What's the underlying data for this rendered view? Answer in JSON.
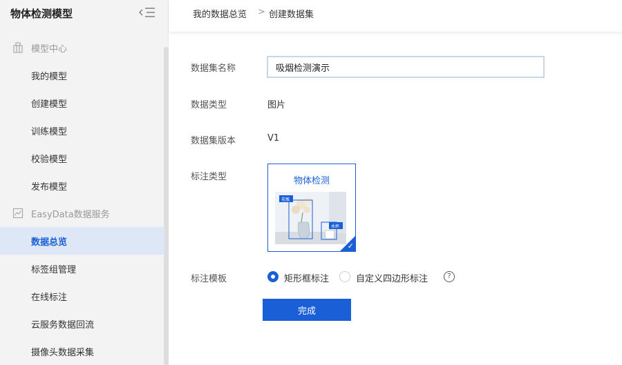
{
  "sidebar": {
    "title": "物体检测模型",
    "groups": [
      {
        "label": "模型中心",
        "icon": "model-center-icon",
        "items": [
          {
            "label": "我的模型"
          },
          {
            "label": "创建模型"
          },
          {
            "label": "训练模型"
          },
          {
            "label": "校验模型"
          },
          {
            "label": "发布模型"
          }
        ]
      },
      {
        "label": "EasyData数据服务",
        "icon": "chart-icon",
        "items": [
          {
            "label": "数据总览",
            "active": true
          },
          {
            "label": "标签组管理"
          },
          {
            "label": "在线标注"
          },
          {
            "label": "云服务数据回流"
          },
          {
            "label": "摄像头数据采集"
          }
        ]
      }
    ]
  },
  "breadcrumb": {
    "parent": "我的数据总览",
    "separator": ">",
    "current": "创建数据集"
  },
  "form": {
    "name_label": "数据集名称",
    "name_value": "吸烟检测演示",
    "type_label": "数据类型",
    "type_value": "图片",
    "version_label": "数据集版本",
    "version_value": "V1",
    "annotation_label": "标注类型",
    "annotation_card": {
      "title": "物体检测",
      "tag1": "花瓶",
      "tag2": "水杯"
    },
    "template_label": "标注模板",
    "template_options": [
      {
        "label": "矩形框标注",
        "selected": true
      },
      {
        "label": "自定义四边形标注",
        "selected": false
      }
    ],
    "help": "?",
    "submit_label": "完成"
  },
  "colors": {
    "accent": "#1a5fd6",
    "sidebar_bg": "#f3f3f3",
    "active_bg": "#dde7f5"
  }
}
